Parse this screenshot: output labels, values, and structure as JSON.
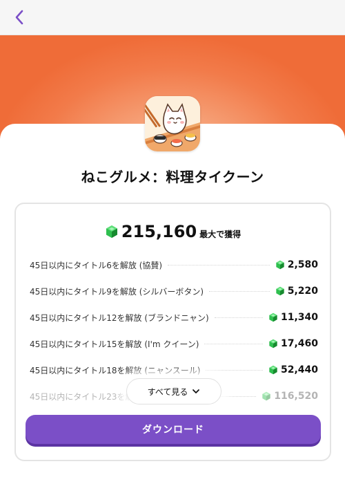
{
  "nav": {
    "back_icon": "chevron-left-icon"
  },
  "app": {
    "title": "ねこグルメ：料理タイクーン",
    "icon": "cat-sushi-app-icon"
  },
  "offer": {
    "total_value": "215,160",
    "total_suffix": "最大で獲得",
    "currency_icon": "green-gem-icon",
    "tasks": [
      {
        "label": "45日以内にタイトル6を解放 (協賛)",
        "reward": "2,580"
      },
      {
        "label": "45日以内にタイトル9を解放 (シルバーボタン)",
        "reward": "5,220"
      },
      {
        "label": "45日以内にタイトル12を解放 (ブランドニャン)",
        "reward": "11,340"
      },
      {
        "label": "45日以内にタイトル15を解放 (I'm クイーン)",
        "reward": "17,460"
      },
      {
        "label": "45日以内にタイトル18を解放 (ニャンスール)",
        "reward": "52,440"
      },
      {
        "label": "45日以内にタイトル23を解",
        "reward": "116,520"
      }
    ],
    "show_all_label": "すべて見る",
    "download_label": "ダウンロード"
  },
  "colors": {
    "accent": "#7b4fc7",
    "hero_orange": "#f27b4a",
    "gem_green": "#2fbf4f"
  }
}
